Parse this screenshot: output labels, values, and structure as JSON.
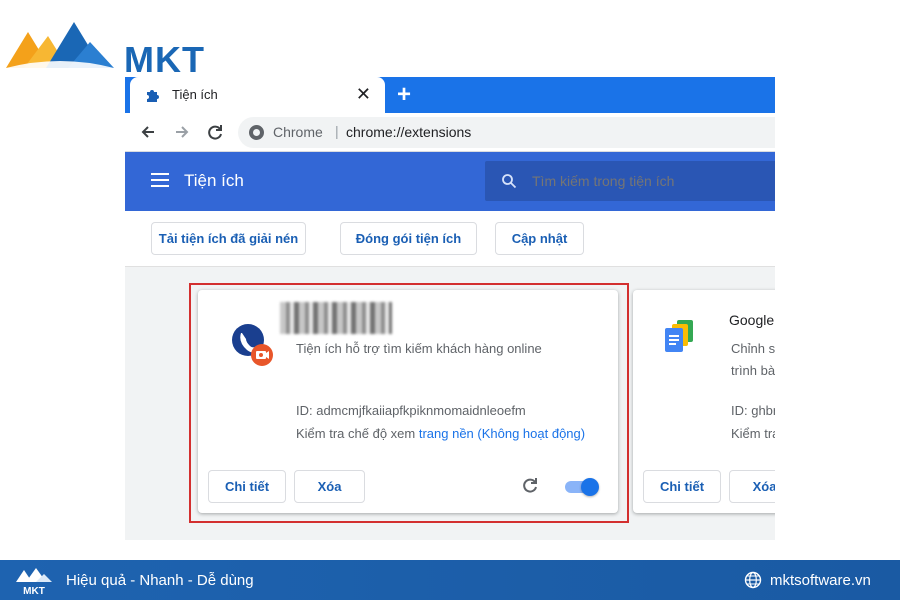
{
  "brand": {
    "logo_text": "MKT",
    "footer_logo_text": "MKT",
    "tagline": "Hiệu quả - Nhanh - Dễ dùng",
    "website": "mktsoftware.vn",
    "colors": {
      "primary": "#1a67b5",
      "accent": "#f4a11a"
    }
  },
  "browser": {
    "tab": {
      "title": "Tiện ích",
      "icon": "puzzle-icon",
      "close_label": "✕"
    },
    "new_tab_label": "+",
    "omnibox": {
      "label": "Chrome",
      "separator": "|",
      "url": "chrome://extensions"
    }
  },
  "extensions_page": {
    "title": "Tiện ích",
    "search_placeholder": "Tìm kiếm trong tiện ích",
    "actions": {
      "load_unpacked": "Tải tiện ích đã giải nén",
      "pack": "Đóng gói tiện ích",
      "update": "Cập nhật"
    },
    "cards": [
      {
        "name_redacted": true,
        "description": "Tiện ích hỗ trợ tìm kiếm khách hàng online",
        "id": "ID: admcmjfkaiiapfkpiknmomaidnleoefm",
        "inspect_prefix": "Kiểm tra chế độ xem",
        "inspect_link": "trang nền (Không hoạt động)",
        "details_label": "Chi tiết",
        "remove_label": "Xóa",
        "enabled": true
      },
      {
        "name": "Google",
        "description_line1": "Chỉnh s",
        "description_line2": "trình bà",
        "id": "ID: ghbr",
        "inspect_prefix": "Kiểm tra",
        "details_label": "Chi tiết",
        "remove_label": "Xóa"
      }
    ]
  }
}
